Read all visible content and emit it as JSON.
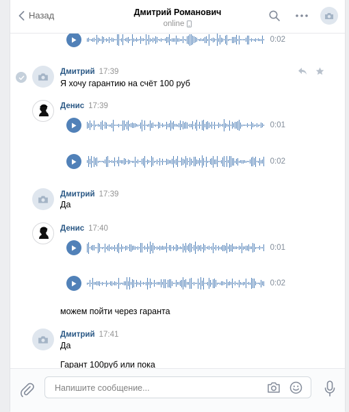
{
  "header": {
    "back_label": "Назад",
    "contact_name": "Дмитрий Романович",
    "status": "online"
  },
  "messages": [
    {
      "type": "audio",
      "duration": "0:02"
    },
    {
      "type": "text",
      "author": "Дмитрий",
      "time": "17:39",
      "text": "Я хочу гарантию на счёт 100 руб"
    },
    {
      "type": "audio_group",
      "author": "Денис",
      "time": "17:39",
      "audio": [
        {
          "duration": "0:01"
        },
        {
          "duration": "0:02"
        }
      ]
    },
    {
      "type": "text",
      "author": "Дмитрий",
      "time": "17:39",
      "text": "Да"
    },
    {
      "type": "audio_group",
      "author": "Денис",
      "time": "17:40",
      "audio": [
        {
          "duration": "0:01"
        },
        {
          "duration": "0:02"
        }
      ],
      "text": "можем пойти через гаранта"
    },
    {
      "type": "text",
      "author": "Дмитрий",
      "time": "17:41",
      "text": "Да",
      "text2": "Гарант 100руб или пока"
    }
  ],
  "composer": {
    "placeholder": "Напишите сообщение..."
  },
  "colors": {
    "accent": "#5181b8",
    "author": "#2a5885",
    "muted": "#939393",
    "background": "#edeef0"
  },
  "icons": {
    "back": "chevron-left-icon",
    "search": "search-icon",
    "more": "more-dots-icon",
    "avatar": "camera-placeholder-icon",
    "play": "play-icon",
    "reply": "reply-icon",
    "star": "star-icon",
    "attach": "paperclip-icon",
    "camera": "camera-icon",
    "emoji": "smile-icon",
    "mic": "microphone-icon",
    "phone": "phone-icon",
    "check": "check-icon"
  }
}
